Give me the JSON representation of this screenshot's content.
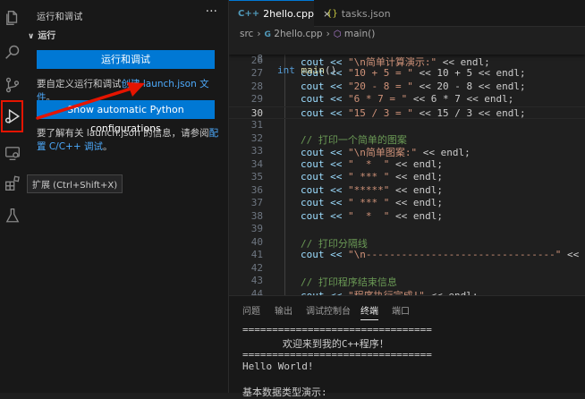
{
  "sidebar": {
    "title": "运行和调试",
    "more": "···",
    "section": "运行",
    "run_button": "运行和调试",
    "custom_text_1": "要自定义运行和调试",
    "custom_link": "创建 launch.json 文件",
    "custom_text_2": "。",
    "python_button": "Show automatic Python configurations",
    "info_text": "要了解有关 launch.json 的信息，请参阅",
    "info_link": "配置 C/C++ 调试",
    "info_end": "。"
  },
  "tooltip": "扩展 (Ctrl+Shift+X)",
  "activity_icons": [
    "files-icon",
    "search-icon",
    "source-control-icon",
    "run-debug-icon",
    "remote-explorer-icon",
    "extensions-icon",
    "testing-icon"
  ],
  "tabs": [
    {
      "icon": "C++",
      "label": "2hello.cpp",
      "close": "×",
      "active": true
    },
    {
      "icon": "{}",
      "label": "tasks.json",
      "active": false
    }
  ],
  "breadcrumb": {
    "folder": "src",
    "file": "2hello.cpp",
    "symbol": "main()"
  },
  "editor": {
    "sticky": {
      "num": "8",
      "kw": "int",
      "fn": "main",
      "rest": "()"
    },
    "lines": [
      {
        "num": "26",
        "a": "cout << ",
        "s": "\"\\n简单计算演示:\"",
        "b": " << endl;"
      },
      {
        "num": "27",
        "a": "cout << ",
        "s": "\"10 + 5 = \"",
        "b": " << 10 + 5 << endl;"
      },
      {
        "num": "28",
        "a": "cout << ",
        "s": "\"20 - 8 = \"",
        "b": " << 20 - 8 << endl;"
      },
      {
        "num": "29",
        "a": "cout << ",
        "s": "\"6 * 7 = \"",
        "b": " << 6 * 7 << endl;"
      },
      {
        "num": "30",
        "a": "cout << ",
        "s": "\"15 / 3 = \"",
        "b": " << 15 / 3 << endl;"
      },
      {
        "num": "31",
        "a": "",
        "s": "",
        "b": ""
      },
      {
        "num": "32",
        "c": "// 打印一个简单的图案"
      },
      {
        "num": "33",
        "a": "cout << ",
        "s": "\"\\n简单图案:\"",
        "b": " << endl;"
      },
      {
        "num": "34",
        "a": "cout << ",
        "s": "\"  *  \"",
        "b": " << endl;"
      },
      {
        "num": "35",
        "a": "cout << ",
        "s": "\" *** \"",
        "b": " << endl;"
      },
      {
        "num": "36",
        "a": "cout << ",
        "s": "\"*****\"",
        "b": " << endl;"
      },
      {
        "num": "37",
        "a": "cout << ",
        "s": "\" *** \"",
        "b": " << endl;"
      },
      {
        "num": "38",
        "a": "cout << ",
        "s": "\"  *  \"",
        "b": " << endl;"
      },
      {
        "num": "39",
        "a": "",
        "s": "",
        "b": ""
      },
      {
        "num": "40",
        "c": "// 打印分隔线"
      },
      {
        "num": "41",
        "a": "cout << ",
        "s": "\"\\n--------------------------------\"",
        "b": " << en"
      },
      {
        "num": "42",
        "a": "",
        "s": "",
        "b": ""
      },
      {
        "num": "43",
        "c": "// 打印程序结束信息"
      },
      {
        "num": "44",
        "a": "cout << ",
        "s": "\"程序执行完成!\"",
        "b": " << endl;"
      }
    ]
  },
  "panel": {
    "tabs": [
      "问题",
      "输出",
      "调试控制台",
      "终端",
      "端口"
    ],
    "active_tab": "终端",
    "terminal": [
      "================================",
      "   欢迎来到我的C++程序！",
      "================================",
      "Hello World!",
      "",
      "基本数据类型演示:"
    ]
  },
  "colors": {
    "accent": "#0078d4",
    "highlight": "#e51400"
  }
}
